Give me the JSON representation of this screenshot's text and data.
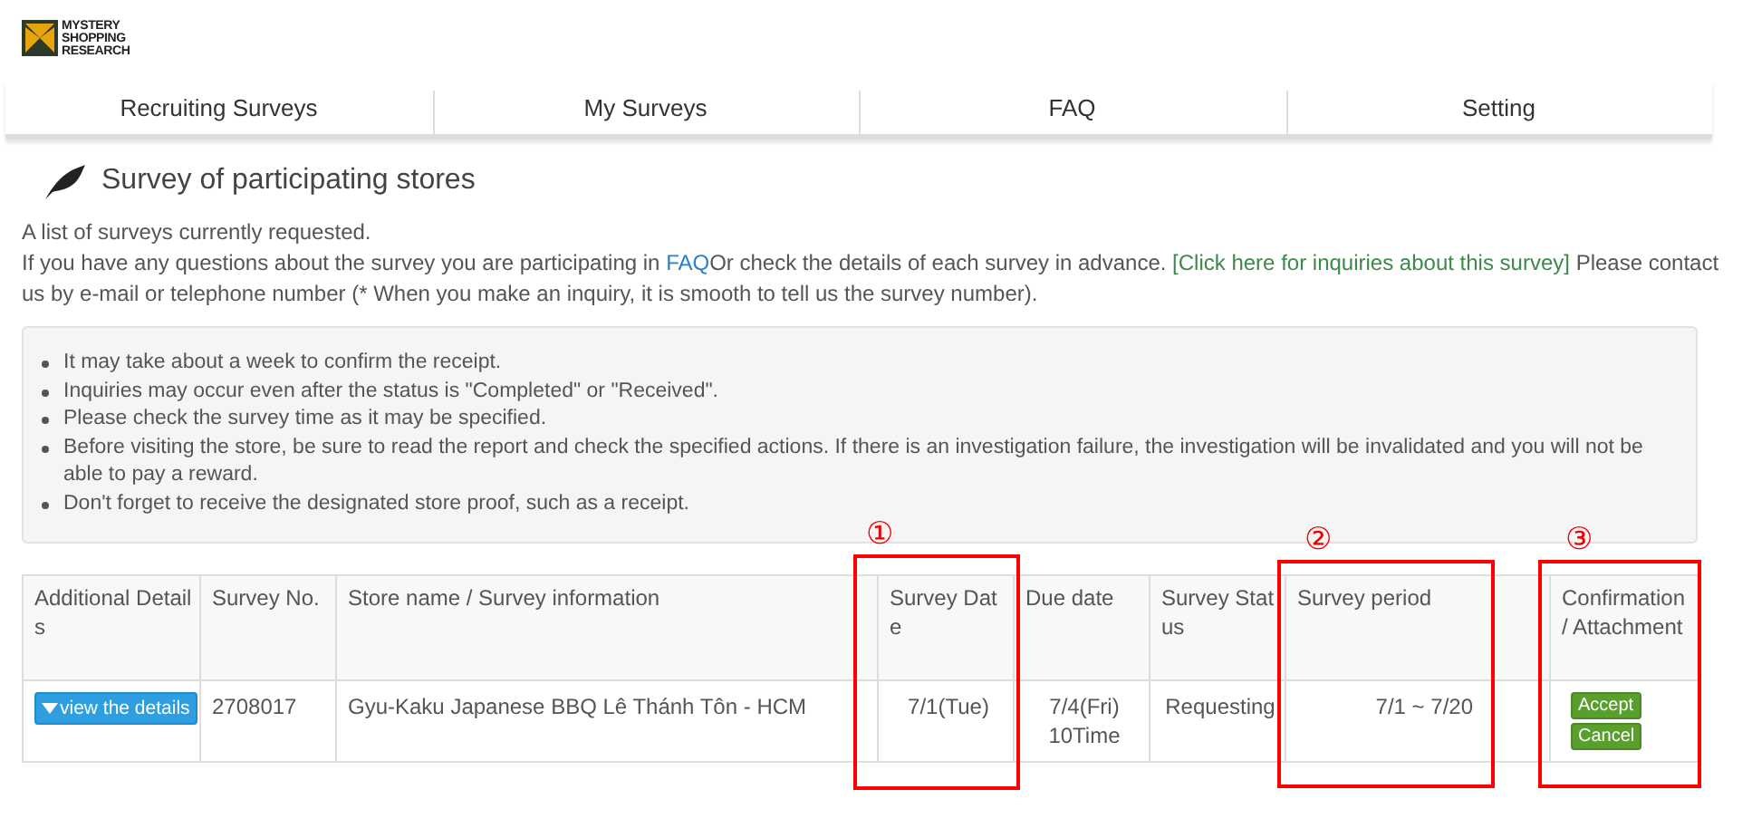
{
  "logo": {
    "lines": [
      "MYSTERY",
      "SHOPPING",
      "RESEARCH"
    ]
  },
  "nav": [
    {
      "label": "Recruiting Surveys"
    },
    {
      "label": "My Surveys"
    },
    {
      "label": "FAQ"
    },
    {
      "label": "Setting"
    }
  ],
  "heading": "Survey of participating stores",
  "intro": "A list of surveys currently requested.",
  "help": [
    {
      "kind": "text",
      "text": "If you have any questions about the survey you are participating in "
    },
    {
      "kind": "link",
      "text": "FAQ",
      "color": "#2a7fc9"
    },
    {
      "kind": "text",
      "text": "Or check the details of each survey in advance. "
    },
    {
      "kind": "link",
      "text": "[Click here for inquiries about this survey]",
      "color": "#3c8a4a"
    },
    {
      "kind": "text",
      "text": " Please contact us by e-mail or telephone number (* When you make an inquiry, it is smooth to tell us the survey number)."
    }
  ],
  "notices": [
    "It may take about a week to confirm the receipt.",
    "Inquiries may occur even after the status is \"Completed\" or \"Received\".",
    "Please check the survey time as it may be specified.",
    "Before visiting the store, be sure to read the report and check the specified actions. If there is an investigation failure, the investigation will be invalidated and you will not be able to pay a reward.",
    "Don't forget to receive the designated store proof, such as a receipt."
  ],
  "table": {
    "columns": [
      "Additional Details",
      "Survey No.",
      "Store name / Survey information",
      "Survey Date",
      "Due date",
      "Survey Status",
      "Survey period",
      "Confirmation / Attachment"
    ],
    "rows": [
      {
        "details_button": "view the details",
        "survey_no": "2708017",
        "store": "Gyu-Kaku Japanese BBQ Lê Thánh Tôn - HCM",
        "survey_date": "7/1(Tue)",
        "due_date": [
          "7/4(Fri)",
          "10Time"
        ],
        "status": "Requesting",
        "period": "7/1 ~ 7/20",
        "actions": [
          "Accept",
          "Cancel"
        ]
      }
    ]
  },
  "annotations": [
    {
      "label": "①"
    },
    {
      "label": "②"
    },
    {
      "label": "③"
    }
  ]
}
